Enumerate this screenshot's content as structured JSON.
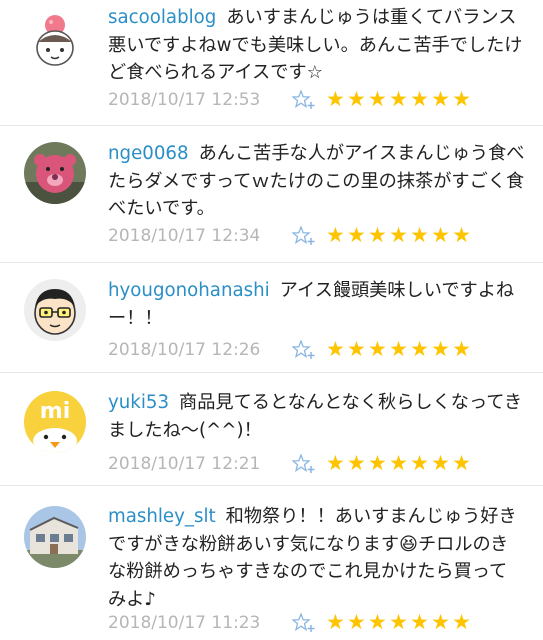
{
  "comments": [
    {
      "username": "sacoolablog",
      "text": "あいすまんじゅうは重くてバランス悪いですよねwでも美味しい。あんこ苦手でしたけど食べられるアイスです☆",
      "timestamp": "2018/10/17 12:53",
      "star_count": 7,
      "stars": "★★★★★★★",
      "avatar": "cartoon-face-pink-bun-hair"
    },
    {
      "username": "nge0068",
      "text": "あんこ苦手な人がアイスまんじゅう食べたらダメですってｗたけのこの里の抹茶がすごく食べたいです。",
      "timestamp": "2018/10/17 12:34",
      "star_count": 7,
      "stars": "★★★★★★★",
      "avatar": "pink-bear-toy-photo"
    },
    {
      "username": "hyougonohanashi",
      "text": "アイス饅頭美味しいですよねー！！",
      "timestamp": "2018/10/17 12:26",
      "star_count": 7,
      "stars": "★★★★★★★",
      "avatar": "cartoon-man-with-glasses"
    },
    {
      "username": "yuki53",
      "text": "商品見てるとなんとなく秋らしくなってきましたね〜(^^)！",
      "timestamp": "2018/10/17 12:21",
      "star_count": 7,
      "stars": "★★★★★★★",
      "avatar": "yellow-mi-chick-logo"
    },
    {
      "username": "mashley_slt",
      "text": "和物祭り！！あいすまんじゅう好きですがきな粉餅あいす気になります😆チロルのきな粉餅めっちゃすきなのでこれ見かけたら買ってみよ♪",
      "timestamp": "2018/10/17 11:23",
      "star_count": 7,
      "stars": "★★★★★★★",
      "avatar": "house-photo"
    }
  ],
  "colors": {
    "username": "#2b8fc7",
    "timestamp": "#b6b6b6",
    "star": "#ffc400",
    "add_star_icon": "#8ab6e0"
  },
  "icons": {
    "add_star": "add-star-icon"
  }
}
